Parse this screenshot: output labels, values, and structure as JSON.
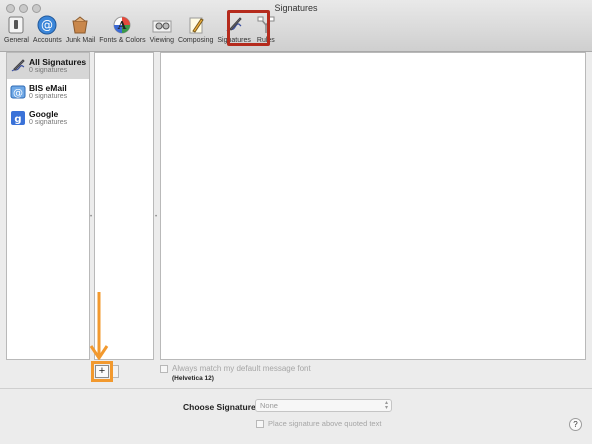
{
  "window": {
    "title": "Signatures"
  },
  "toolbar": {
    "items": [
      {
        "label": "General",
        "icon": "general-switch-icon"
      },
      {
        "label": "Accounts",
        "icon": "at-sign-icon"
      },
      {
        "label": "Junk Mail",
        "icon": "junk-mail-icon"
      },
      {
        "label": "Fonts & Colors",
        "icon": "fonts-colors-icon"
      },
      {
        "label": "Viewing",
        "icon": "glasses-icon"
      },
      {
        "label": "Composing",
        "icon": "pencil-notepad-icon"
      },
      {
        "label": "Signatures",
        "icon": "signature-pen-icon"
      },
      {
        "label": "Rules",
        "icon": "rules-icon"
      }
    ],
    "selected": "Signatures"
  },
  "accounts": {
    "items": [
      {
        "name": "All Signatures",
        "count": "0 signatures",
        "icon": "signature-pen-icon"
      },
      {
        "name": "BIS eMail",
        "count": "0 signatures",
        "icon": "mail-at-icon"
      },
      {
        "name": "Google",
        "count": "0 signatures",
        "icon": "google-icon"
      }
    ]
  },
  "buttons": {
    "add": "+",
    "remove": "-"
  },
  "options": {
    "match_font_label": "Always match my default message font",
    "font_note": "(Helvetica 12)",
    "choose_signature_label": "Choose Signature:",
    "choose_signature_value": "None",
    "place_above_label": "Place signature above quoted text"
  },
  "help": "?",
  "colors": {
    "highlight": "#b52b1d",
    "annotation": "#f2992e"
  }
}
